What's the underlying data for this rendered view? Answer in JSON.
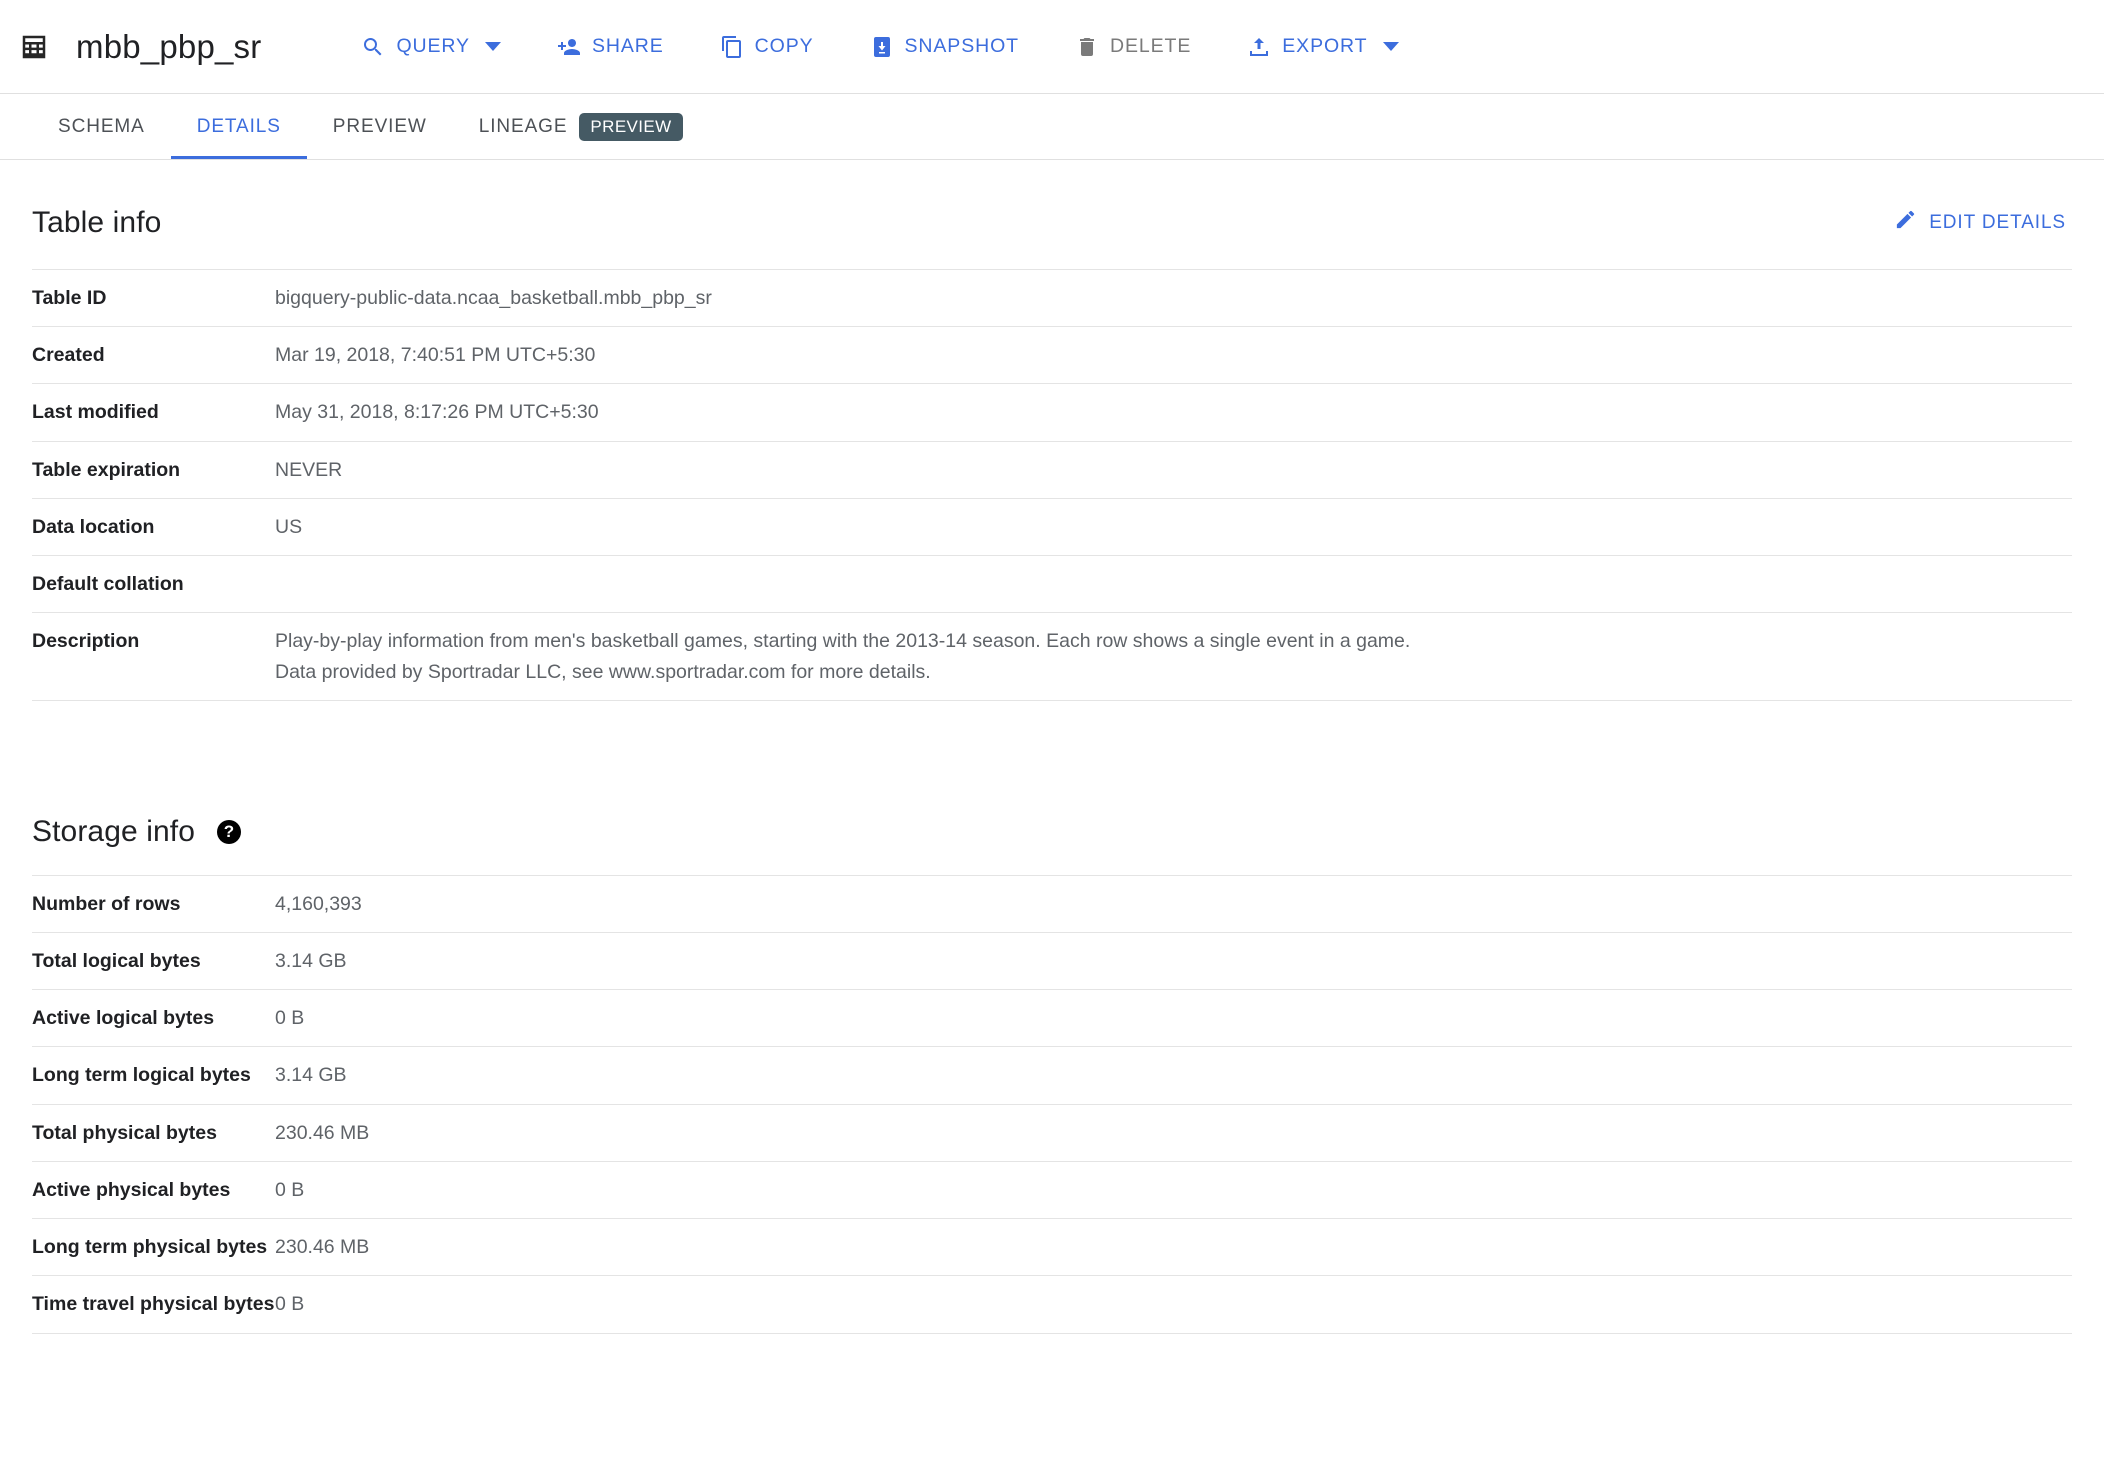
{
  "header": {
    "icon": "table-grid-icon",
    "title": "mbb_pbp_sr",
    "actions": [
      {
        "id": "query",
        "label": "QUERY",
        "icon": "search-icon",
        "has_caret": true,
        "disabled": false
      },
      {
        "id": "share",
        "label": "SHARE",
        "icon": "person-add-icon",
        "has_caret": false,
        "disabled": false
      },
      {
        "id": "copy",
        "label": "COPY",
        "icon": "copy-icon",
        "has_caret": false,
        "disabled": false
      },
      {
        "id": "snapshot",
        "label": "SNAPSHOT",
        "icon": "snapshot-icon",
        "has_caret": false,
        "disabled": false
      },
      {
        "id": "delete",
        "label": "DELETE",
        "icon": "trash-icon",
        "has_caret": false,
        "disabled": true
      },
      {
        "id": "export",
        "label": "EXPORT",
        "icon": "export-icon",
        "has_caret": true,
        "disabled": false
      }
    ]
  },
  "tabs": [
    {
      "id": "schema",
      "label": "SCHEMA",
      "active": false,
      "badge": ""
    },
    {
      "id": "details",
      "label": "DETAILS",
      "active": true,
      "badge": ""
    },
    {
      "id": "preview",
      "label": "PREVIEW",
      "active": false,
      "badge": ""
    },
    {
      "id": "lineage",
      "label": "LINEAGE",
      "active": false,
      "badge": "PREVIEW"
    }
  ],
  "table_info": {
    "title": "Table info",
    "edit_label": "EDIT DETAILS",
    "rows": [
      {
        "key": "Table ID",
        "value": "bigquery-public-data.ncaa_basketball.mbb_pbp_sr"
      },
      {
        "key": "Created",
        "value": "Mar 19, 2018, 7:40:51 PM UTC+5:30"
      },
      {
        "key": "Last modified",
        "value": "May 31, 2018, 8:17:26 PM UTC+5:30"
      },
      {
        "key": "Table expiration",
        "value": "NEVER"
      },
      {
        "key": "Data location",
        "value": "US"
      },
      {
        "key": "Default collation",
        "value": ""
      }
    ],
    "description": {
      "key": "Description",
      "line1": "Play-by-play information from men's basketball games, starting with the 2013-14 season. Each row shows a single event in a game.",
      "line2": "Data provided by Sportradar LLC, see www.sportradar.com for more details."
    }
  },
  "storage_info": {
    "title": "Storage info",
    "help_icon": "help-icon",
    "rows": [
      {
        "key": "Number of rows",
        "value": "4,160,393"
      },
      {
        "key": "Total logical bytes",
        "value": "3.14 GB"
      },
      {
        "key": "Active logical bytes",
        "value": "0 B"
      },
      {
        "key": "Long term logical bytes",
        "value": "3.14 GB"
      },
      {
        "key": "Total physical bytes",
        "value": "230.46 MB"
      },
      {
        "key": "Active physical bytes",
        "value": "0 B"
      },
      {
        "key": "Long term physical bytes",
        "value": "230.46 MB"
      },
      {
        "key": "Time travel physical bytes",
        "value": "0 B"
      }
    ]
  },
  "colors": {
    "accent": "#3c6ddd",
    "badge_bg": "#455a64",
    "value_text": "#5f6368",
    "disabled_text": "#7a7a7a"
  }
}
